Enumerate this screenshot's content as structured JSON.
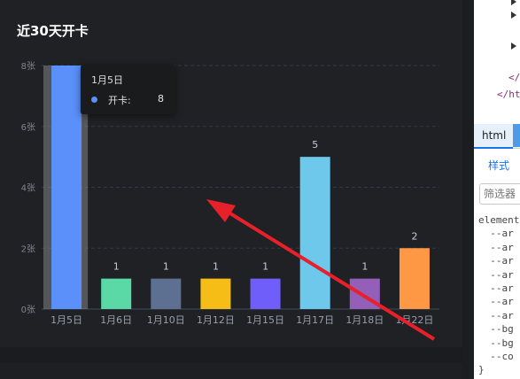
{
  "chart": {
    "title": "近30天开卡"
  },
  "tooltip": {
    "title": "1月5日",
    "series_name": "开卡:",
    "value": "8"
  },
  "chart_data": {
    "type": "bar",
    "categories": [
      "1月5日",
      "1月6日",
      "1月10日",
      "1月12日",
      "1月15日",
      "1月17日",
      "1月18日",
      "1月22日"
    ],
    "values": [
      8,
      1,
      1,
      1,
      1,
      5,
      1,
      2
    ],
    "colors": [
      "#5b8ff9",
      "#5ad8a6",
      "#5d7092",
      "#f6bd16",
      "#6f5ef9",
      "#6dc8ec",
      "#945fb9",
      "#ff9845"
    ],
    "y_tick_labels": [
      "0张",
      "2张",
      "4张",
      "6张",
      "8张"
    ],
    "ylim": [
      0,
      8
    ],
    "grid": true,
    "highlighted_category": "1月5日"
  },
  "devtools": {
    "dom_lines": [
      "</",
      "</ht"
    ],
    "tab_label": "html",
    "styles_label": "样式",
    "filter_placeholder": "筛选器",
    "styles_text": "element.\n  --ar\n  --ar\n  --ar\n  --ar\n  --ar\n  --ar\n  --ar\n  --bg\n  --bg\n  --co\n}"
  },
  "annotation": {
    "arrow_color": "#e8202a"
  }
}
